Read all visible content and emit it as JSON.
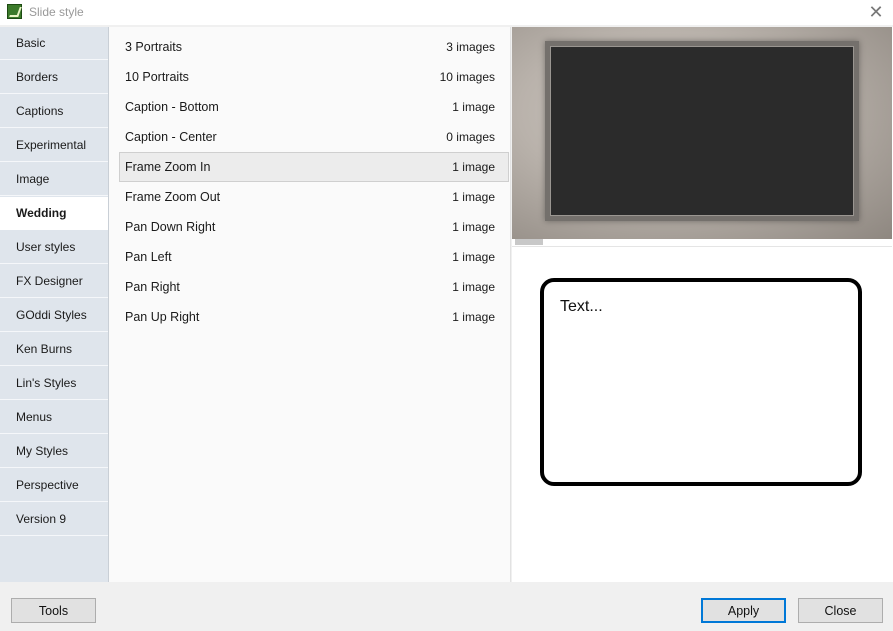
{
  "window": {
    "title": "Slide style",
    "close_glyph": "✕",
    "icon": "app-icon"
  },
  "sidebar": {
    "items": [
      {
        "label": "Basic",
        "active": false
      },
      {
        "label": "Borders",
        "active": false
      },
      {
        "label": "Captions",
        "active": false
      },
      {
        "label": "Experimental",
        "active": false
      },
      {
        "label": "Image",
        "active": false
      },
      {
        "label": "Wedding",
        "active": true
      },
      {
        "label": "User styles",
        "active": false
      },
      {
        "label": "FX Designer",
        "active": false
      },
      {
        "label": "GOddi Styles",
        "active": false
      },
      {
        "label": "Ken Burns",
        "active": false
      },
      {
        "label": "Lin's Styles",
        "active": false
      },
      {
        "label": "Menus",
        "active": false
      },
      {
        "label": "My Styles",
        "active": false
      },
      {
        "label": "Perspective",
        "active": false
      },
      {
        "label": "Version 9",
        "active": false
      }
    ]
  },
  "styles_list": {
    "selected_index": 4,
    "rows": [
      {
        "name": "3 Portraits",
        "count": "3 images"
      },
      {
        "name": "10 Portraits",
        "count": "10 images"
      },
      {
        "name": "Caption - Bottom",
        "count": "1 image"
      },
      {
        "name": "Caption - Center",
        "count": "0 images"
      },
      {
        "name": "Frame Zoom In",
        "count": "1 image"
      },
      {
        "name": "Frame Zoom Out",
        "count": "1 image"
      },
      {
        "name": "Pan Down Right",
        "count": "1 image"
      },
      {
        "name": "Pan Left",
        "count": "1 image"
      },
      {
        "name": "Pan Right",
        "count": "1 image"
      },
      {
        "name": "Pan Up Right",
        "count": "1 image"
      }
    ]
  },
  "preview": {
    "text_placeholder": "Text..."
  },
  "buttons": {
    "tools": "Tools",
    "apply": "Apply",
    "close": "Close"
  },
  "colors": {
    "sidebar_bg": "#dfe5ec",
    "selection_border": "#cfcfcf",
    "apply_focus": "#0078d7"
  }
}
